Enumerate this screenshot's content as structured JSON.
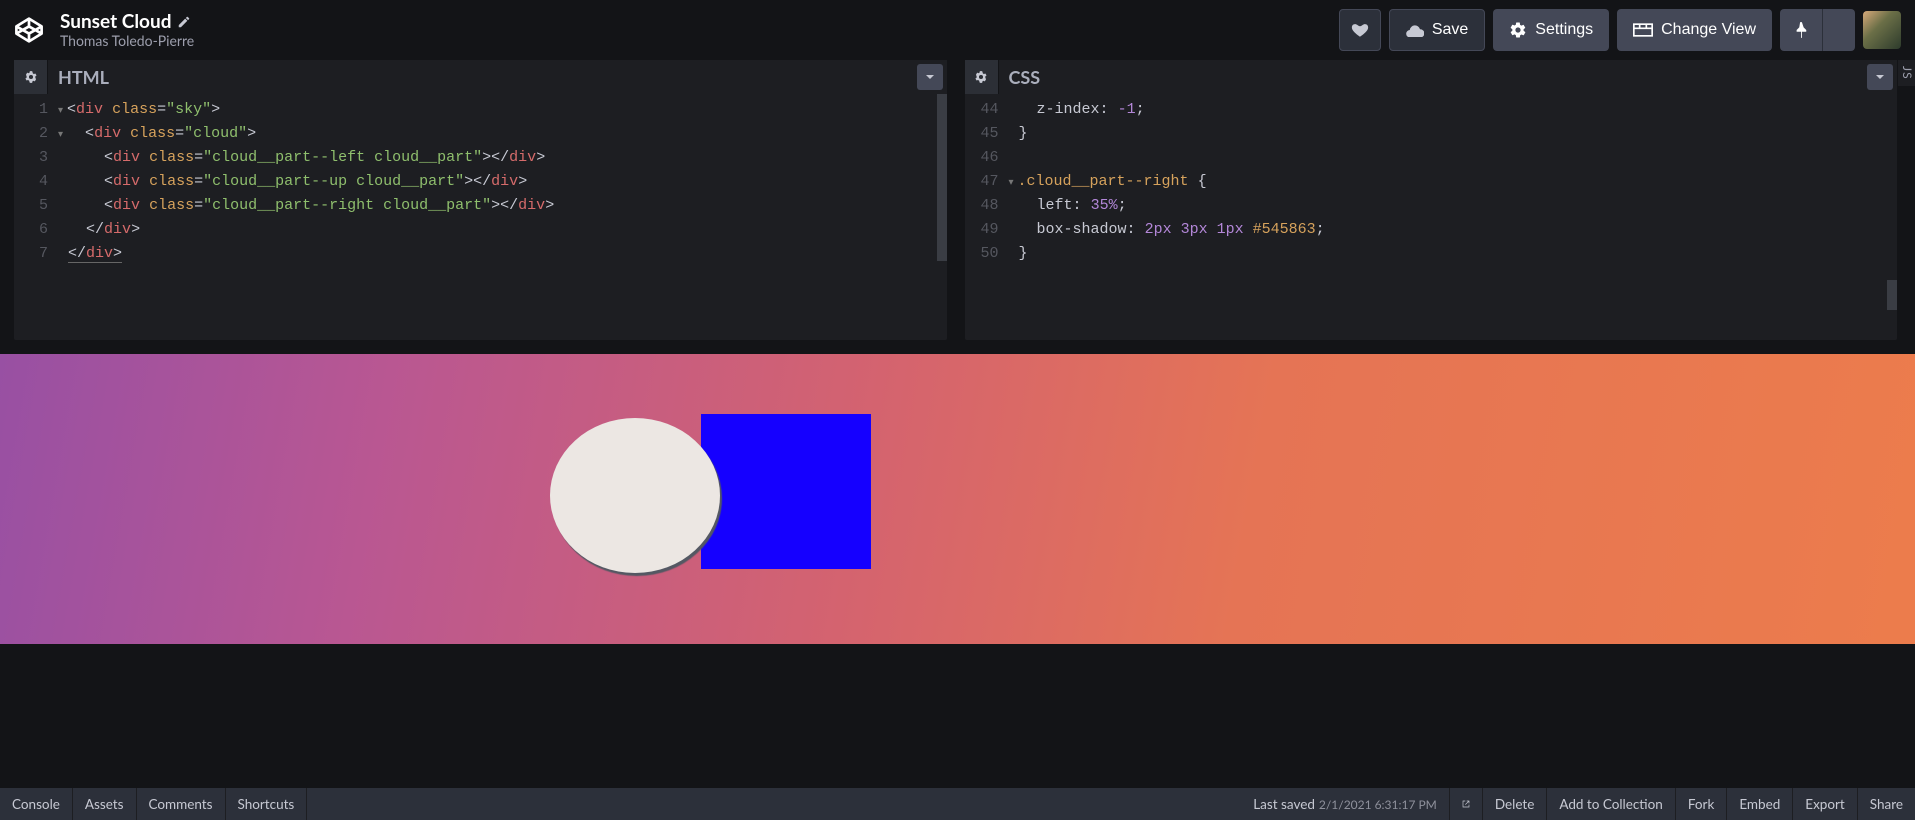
{
  "header": {
    "pen_title": "Sunset Cloud",
    "author": "Thomas Toledo-Pierre",
    "buttons": {
      "save": "Save",
      "settings": "Settings",
      "change_view": "Change View"
    }
  },
  "panels": {
    "html": {
      "title": "HTML",
      "line_start": 1,
      "lines": [
        {
          "n": 1,
          "fold": true,
          "tokens": [
            [
              "punc",
              "<"
            ],
            [
              "tag",
              "div"
            ],
            [
              "punc",
              " "
            ],
            [
              "attr",
              "class"
            ],
            [
              "punc",
              "="
            ],
            [
              "str",
              "\"sky\""
            ],
            [
              "punc",
              ">"
            ]
          ]
        },
        {
          "n": 2,
          "fold": true,
          "indent": 2,
          "tokens": [
            [
              "punc",
              "<"
            ],
            [
              "tag",
              "div"
            ],
            [
              "punc",
              " "
            ],
            [
              "attr",
              "class"
            ],
            [
              "punc",
              "="
            ],
            [
              "str",
              "\"cloud\""
            ],
            [
              "punc",
              ">"
            ]
          ]
        },
        {
          "n": 3,
          "indent": 4,
          "tokens": [
            [
              "punc",
              "<"
            ],
            [
              "tag",
              "div"
            ],
            [
              "punc",
              " "
            ],
            [
              "attr",
              "class"
            ],
            [
              "punc",
              "="
            ],
            [
              "str",
              "\"cloud__part--left cloud__part\""
            ],
            [
              "punc",
              "></"
            ],
            [
              "tag",
              "div"
            ],
            [
              "punc",
              ">"
            ]
          ]
        },
        {
          "n": 4,
          "indent": 4,
          "tokens": [
            [
              "punc",
              "<"
            ],
            [
              "tag",
              "div"
            ],
            [
              "punc",
              " "
            ],
            [
              "attr",
              "class"
            ],
            [
              "punc",
              "="
            ],
            [
              "str",
              "\"cloud__part--up cloud__part\""
            ],
            [
              "punc",
              "></"
            ],
            [
              "tag",
              "div"
            ],
            [
              "punc",
              ">"
            ]
          ]
        },
        {
          "n": 5,
          "indent": 4,
          "tokens": [
            [
              "punc",
              "<"
            ],
            [
              "tag",
              "div"
            ],
            [
              "punc",
              " "
            ],
            [
              "attr",
              "class"
            ],
            [
              "punc",
              "="
            ],
            [
              "str",
              "\"cloud__part--right cloud__part\""
            ],
            [
              "punc",
              "></"
            ],
            [
              "tag",
              "div"
            ],
            [
              "punc",
              ">"
            ]
          ]
        },
        {
          "n": 6,
          "indent": 2,
          "tokens": [
            [
              "punc",
              "</"
            ],
            [
              "tag",
              "div"
            ],
            [
              "punc",
              ">"
            ]
          ]
        },
        {
          "n": 7,
          "underline": true,
          "tokens": [
            [
              "punc",
              "</"
            ],
            [
              "tag",
              "div"
            ],
            [
              "punc",
              ">"
            ]
          ]
        }
      ]
    },
    "css": {
      "title": "CSS",
      "line_start": 44,
      "lines": [
        {
          "n": 44,
          "indent": 2,
          "tokens": [
            [
              "prop",
              "z-index"
            ],
            [
              "punc",
              ": "
            ],
            [
              "num",
              "-1"
            ],
            [
              "punc",
              ";"
            ]
          ]
        },
        {
          "n": 45,
          "tokens": [
            [
              "punc",
              "}"
            ]
          ]
        },
        {
          "n": 46,
          "tokens": []
        },
        {
          "n": 47,
          "fold": true,
          "tokens": [
            [
              "sel",
              ".cloud__part--right"
            ],
            [
              "punc",
              " {"
            ]
          ]
        },
        {
          "n": 48,
          "indent": 2,
          "tokens": [
            [
              "prop",
              "left"
            ],
            [
              "punc",
              ": "
            ],
            [
              "num",
              "35%"
            ],
            [
              "punc",
              ";"
            ]
          ]
        },
        {
          "n": 49,
          "indent": 2,
          "tokens": [
            [
              "prop",
              "box-shadow"
            ],
            [
              "punc",
              ": "
            ],
            [
              "num",
              "2px"
            ],
            [
              "punc",
              " "
            ],
            [
              "num",
              "3px"
            ],
            [
              "punc",
              " "
            ],
            [
              "num",
              "1px"
            ],
            [
              "punc",
              " "
            ],
            [
              "hex",
              "#545863"
            ],
            [
              "punc",
              ";"
            ]
          ]
        },
        {
          "n": 50,
          "tokens": [
            [
              "punc",
              "}"
            ]
          ]
        }
      ]
    },
    "collapsed_label": "JS"
  },
  "footer": {
    "left": [
      "Console",
      "Assets",
      "Comments",
      "Shortcuts"
    ],
    "saved_label": "Last saved",
    "saved_ts": "2/1/2021 6:31:17 PM",
    "right": [
      "Delete",
      "Add to Collection",
      "Fork",
      "Embed",
      "Export",
      "Share"
    ]
  },
  "colors": {
    "accent_gradient_from": "#9850a3",
    "accent_gradient_to": "#ec7c4c",
    "cloud_box": "#1500ff",
    "cloud_circle": "#ece7e3",
    "cloud_shadow": "#545863"
  }
}
